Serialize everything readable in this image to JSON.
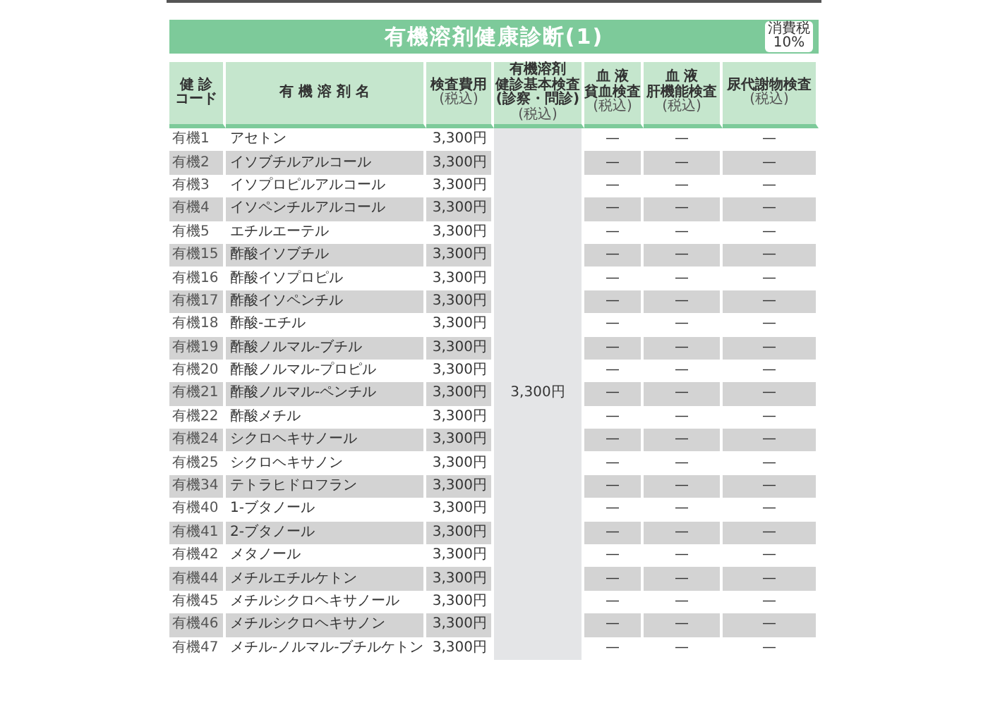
{
  "title": "有機溶剤健康診断(1)",
  "tax_badge": {
    "label": "消費税",
    "rate": "10%"
  },
  "columns": [
    {
      "lines": [
        "健 診",
        "コード"
      ]
    },
    {
      "lines": [
        "有 機 溶 剤 名"
      ]
    },
    {
      "lines": [
        "検査費用"
      ],
      "note": "(税込)"
    },
    {
      "lines": [
        "有機溶剤",
        "健診基本検査",
        "(診察・問診)"
      ],
      "note": "(税込)"
    },
    {
      "lines": [
        "血 液",
        "貧血検査"
      ],
      "note": "(税込)"
    },
    {
      "lines": [
        "血 液",
        "肝機能検査"
      ],
      "note": "(税込)"
    },
    {
      "lines": [
        "尿代謝物検査"
      ],
      "note": "(税込)"
    }
  ],
  "basic_fee": "3,300円",
  "rows": [
    {
      "code": "有機1",
      "name": "アセトン",
      "fee": "3,300円",
      "anemia": "—",
      "liver": "—",
      "urine": "—",
      "shaded": false
    },
    {
      "code": "有機2",
      "name": "イソブチルアルコール",
      "fee": "3,300円",
      "anemia": "—",
      "liver": "—",
      "urine": "—",
      "shaded": true
    },
    {
      "code": "有機3",
      "name": "イソプロピルアルコール",
      "fee": "3,300円",
      "anemia": "—",
      "liver": "—",
      "urine": "—",
      "shaded": false
    },
    {
      "code": "有機4",
      "name": "イソペンチルアルコール",
      "fee": "3,300円",
      "anemia": "—",
      "liver": "—",
      "urine": "—",
      "shaded": true
    },
    {
      "code": "有機5",
      "name": "エチルエーテル",
      "fee": "3,300円",
      "anemia": "—",
      "liver": "—",
      "urine": "—",
      "shaded": false
    },
    {
      "code": "有機15",
      "name": "酢酸イソブチル",
      "fee": "3,300円",
      "anemia": "—",
      "liver": "—",
      "urine": "—",
      "shaded": true
    },
    {
      "code": "有機16",
      "name": "酢酸イソプロピル",
      "fee": "3,300円",
      "anemia": "—",
      "liver": "—",
      "urine": "—",
      "shaded": false
    },
    {
      "code": "有機17",
      "name": "酢酸イソペンチル",
      "fee": "3,300円",
      "anemia": "—",
      "liver": "—",
      "urine": "—",
      "shaded": true
    },
    {
      "code": "有機18",
      "name": "酢酸-エチル",
      "fee": "3,300円",
      "anemia": "—",
      "liver": "—",
      "urine": "—",
      "shaded": false
    },
    {
      "code": "有機19",
      "name": "酢酸ノルマル-ブチル",
      "fee": "3,300円",
      "anemia": "—",
      "liver": "—",
      "urine": "—",
      "shaded": true
    },
    {
      "code": "有機20",
      "name": "酢酸ノルマル-プロピル",
      "fee": "3,300円",
      "anemia": "—",
      "liver": "—",
      "urine": "—",
      "shaded": false
    },
    {
      "code": "有機21",
      "name": "酢酸ノルマル-ペンチル",
      "fee": "3,300円",
      "anemia": "—",
      "liver": "—",
      "urine": "—",
      "shaded": true
    },
    {
      "code": "有機22",
      "name": "酢酸メチル",
      "fee": "3,300円",
      "anemia": "—",
      "liver": "—",
      "urine": "—",
      "shaded": false
    },
    {
      "code": "有機24",
      "name": "シクロヘキサノール",
      "fee": "3,300円",
      "anemia": "—",
      "liver": "—",
      "urine": "—",
      "shaded": true
    },
    {
      "code": "有機25",
      "name": "シクロヘキサノン",
      "fee": "3,300円",
      "anemia": "—",
      "liver": "—",
      "urine": "—",
      "shaded": false
    },
    {
      "code": "有機34",
      "name": "テトラヒドロフラン",
      "fee": "3,300円",
      "anemia": "—",
      "liver": "—",
      "urine": "—",
      "shaded": true
    },
    {
      "code": "有機40",
      "name": "1-ブタノール",
      "fee": "3,300円",
      "anemia": "—",
      "liver": "—",
      "urine": "—",
      "shaded": false
    },
    {
      "code": "有機41",
      "name": "2-ブタノール",
      "fee": "3,300円",
      "anemia": "—",
      "liver": "—",
      "urine": "—",
      "shaded": true
    },
    {
      "code": "有機42",
      "name": "メタノール",
      "fee": "3,300円",
      "anemia": "—",
      "liver": "—",
      "urine": "—",
      "shaded": false
    },
    {
      "code": "有機44",
      "name": "メチルエチルケトン",
      "fee": "3,300円",
      "anemia": "—",
      "liver": "—",
      "urine": "—",
      "shaded": true
    },
    {
      "code": "有機45",
      "name": "メチルシクロヘキサノール",
      "fee": "3,300円",
      "anemia": "—",
      "liver": "—",
      "urine": "—",
      "shaded": false
    },
    {
      "code": "有機46",
      "name": "メチルシクロヘキサノン",
      "fee": "3,300円",
      "anemia": "—",
      "liver": "—",
      "urine": "—",
      "shaded": true
    },
    {
      "code": "有機47",
      "name": "メチル-ノルマル-ブチルケトン",
      "fee": "3,300円",
      "anemia": "—",
      "liver": "—",
      "urine": "—",
      "shaded": false
    }
  ]
}
